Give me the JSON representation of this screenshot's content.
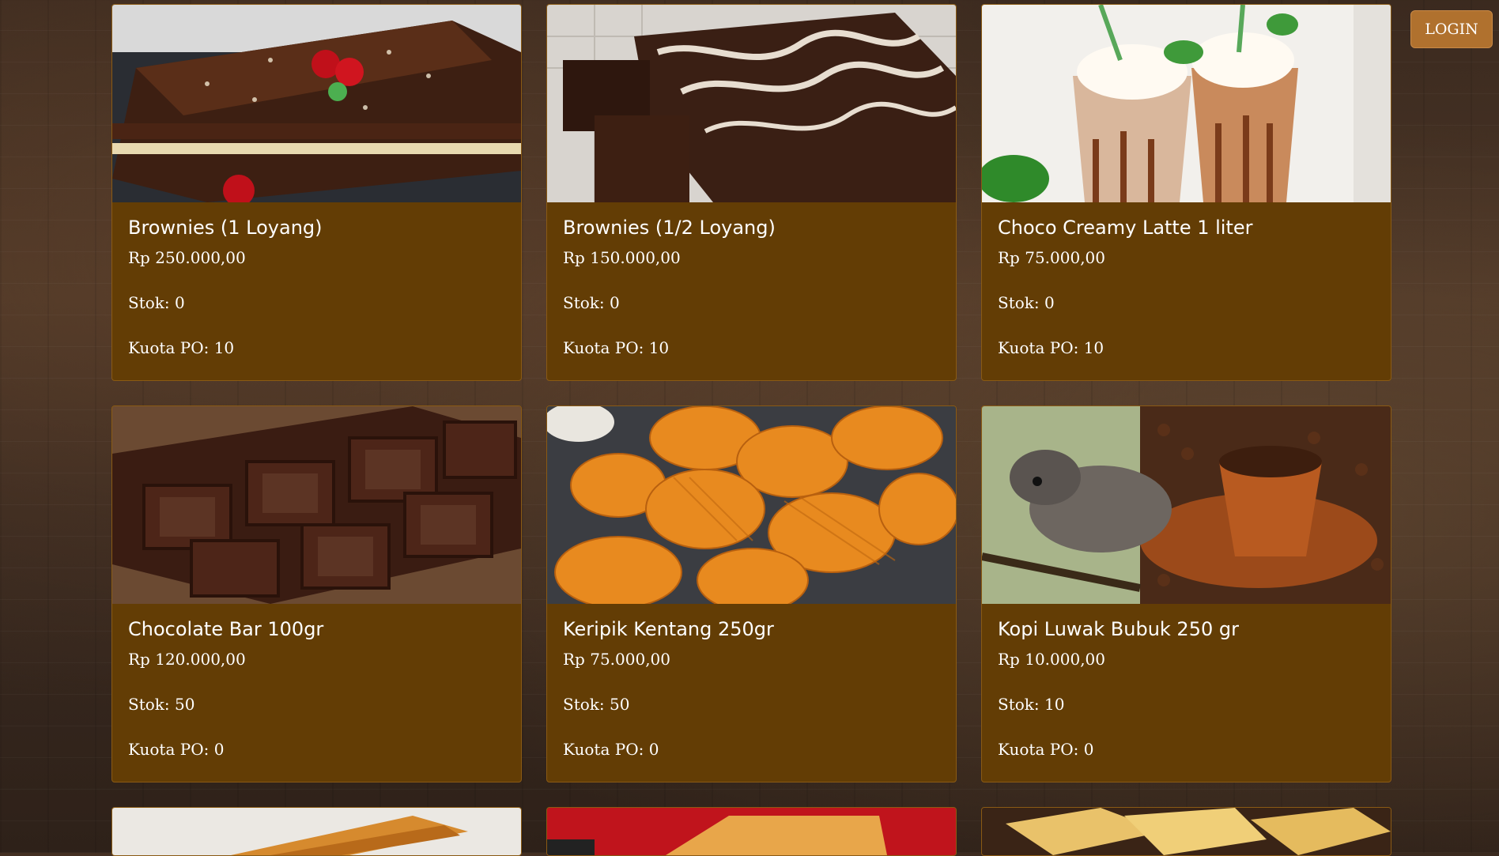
{
  "header": {
    "login_label": "LOGIN"
  },
  "products": [
    {
      "name": "Brownies (1 Loyang)",
      "price": "Rp 250.000,00",
      "stock": "Stok: 0",
      "quota": "Kuota PO: 10",
      "image": "brownies-cake-image"
    },
    {
      "name": "Brownies (1/2 Loyang)",
      "price": "Rp 150.000,00",
      "stock": "Stok: 0",
      "quota": "Kuota PO: 10",
      "image": "marbled-brownie-image"
    },
    {
      "name": "Choco Creamy Latte 1 liter",
      "price": "Rp 75.000,00",
      "stock": "Stok: 0",
      "quota": "Kuota PO: 10",
      "image": "latte-drink-image"
    },
    {
      "name": "Chocolate Bar 100gr",
      "price": "Rp 120.000,00",
      "stock": "Stok: 50",
      "quota": "Kuota PO: 0",
      "image": "chocolate-bar-image"
    },
    {
      "name": "Keripik Kentang 250gr",
      "price": "Rp 75.000,00",
      "stock": "Stok: 50",
      "quota": "Kuota PO: 0",
      "image": "potato-chips-image"
    },
    {
      "name": "Kopi Luwak Bubuk 250 gr",
      "price": "Rp 10.000,00",
      "stock": "Stok: 10",
      "quota": "Kuota PO: 0",
      "image": "civet-coffee-image"
    }
  ],
  "partial_cards": [
    "layer-cake-image",
    "orange-cake-image",
    "cheese-cake-image"
  ],
  "colors": {
    "card_bg": "#633d05",
    "button_bg": "#b0712e",
    "text": "#ffffff"
  }
}
